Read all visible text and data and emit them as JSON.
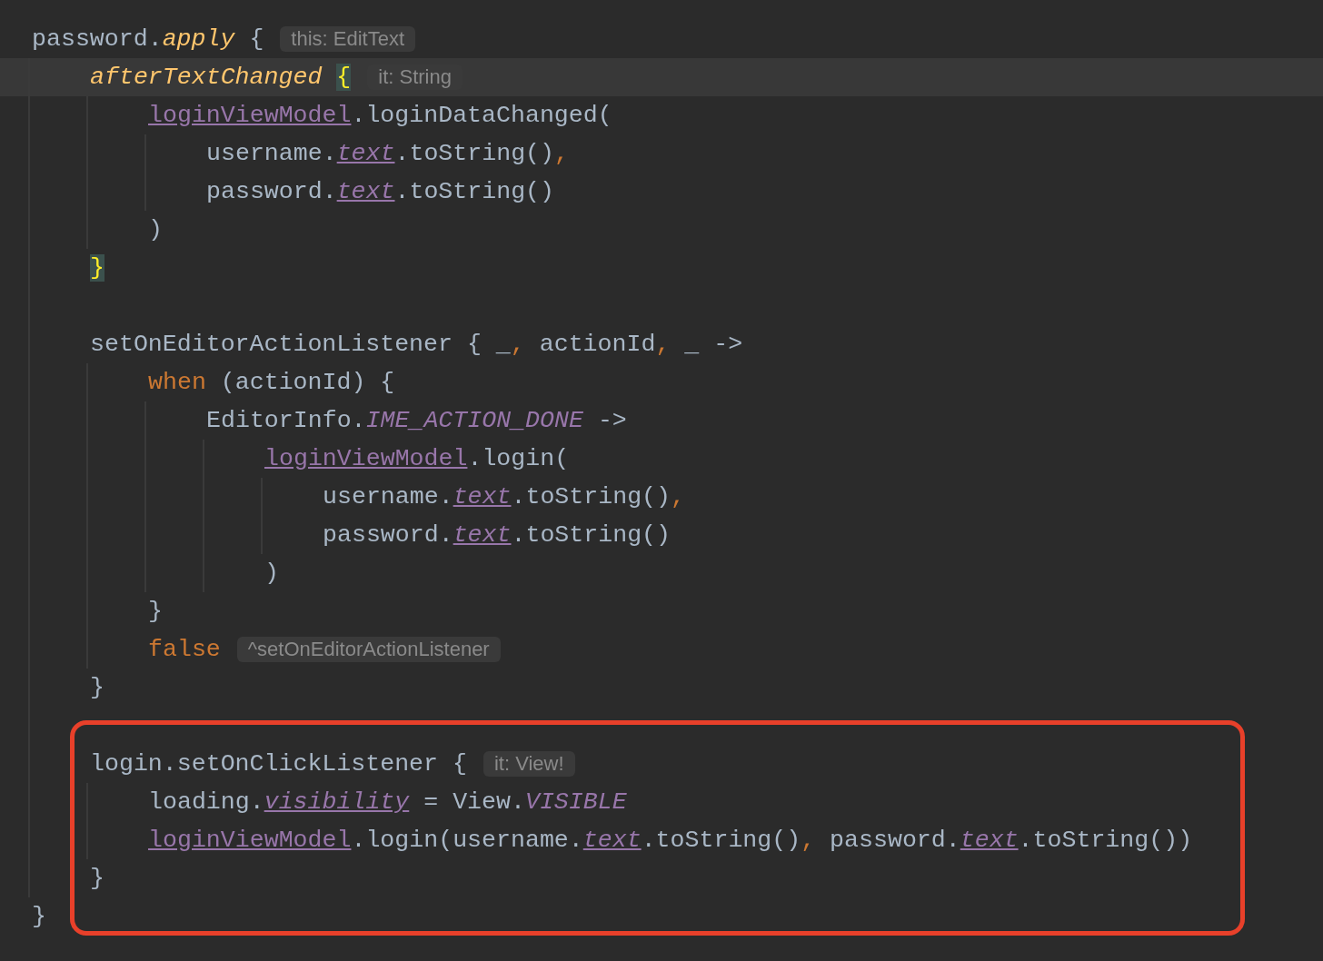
{
  "editor": {
    "lines": [
      {
        "current": false,
        "tokens": [
          {
            "kind": "plain",
            "text": "password."
          },
          {
            "kind": "fn",
            "text": "apply"
          },
          {
            "kind": "plain",
            "text": " {"
          }
        ],
        "hint": "this: EditText",
        "children": [
          {
            "current": true,
            "tokens": [
              {
                "kind": "fn",
                "text": "afterTextChanged"
              },
              {
                "kind": "match",
                "text": "{"
              }
            ],
            "hint": "it: String",
            "children": [
              {
                "current": false,
                "tokens": [
                  {
                    "kind": "ref",
                    "text": "loginViewModel"
                  },
                  {
                    "kind": "plain",
                    "text": ".loginDataChanged("
                  }
                ],
                "children": [
                  {
                    "current": false,
                    "tokens": [
                      {
                        "kind": "plain",
                        "text": "username."
                      },
                      {
                        "kind": "field",
                        "text": "text"
                      },
                      {
                        "kind": "plain",
                        "text": ".toString()"
                      },
                      {
                        "kind": "kw",
                        "text": ","
                      }
                    ]
                  },
                  {
                    "current": false,
                    "tokens": [
                      {
                        "kind": "plain",
                        "text": "password."
                      },
                      {
                        "kind": "field",
                        "text": "text"
                      },
                      {
                        "kind": "plain",
                        "text": ".toString()"
                      }
                    ]
                  }
                ]
              },
              {
                "current": false,
                "tokens": [
                  {
                    "kind": "plain",
                    "text": ")"
                  }
                ]
              }
            ]
          },
          {
            "current": false,
            "tokens": [
              {
                "kind": "match",
                "text": "}"
              }
            ]
          },
          {
            "current": false
          },
          {
            "current": false,
            "tokens": [
              {
                "kind": "plain",
                "text": "setOnEditorActionListener { _"
              },
              {
                "kind": "kw",
                "text": ","
              },
              {
                "kind": "plain",
                "text": " actionId"
              },
              {
                "kind": "kw",
                "text": ","
              },
              {
                "kind": "plain",
                "text": " _ ->"
              }
            ],
            "children": [
              {
                "current": false,
                "tokens": [
                  {
                    "kind": "kw",
                    "text": "when"
                  },
                  {
                    "kind": "plain",
                    "text": " (actionId) {"
                  }
                ],
                "children": [
                  {
                    "current": false,
                    "tokens": [
                      {
                        "kind": "plain",
                        "text": "EditorInfo."
                      },
                      {
                        "kind": "const",
                        "text": "IME_ACTION_DONE"
                      },
                      {
                        "kind": "plain",
                        "text": " ->"
                      }
                    ],
                    "children": [
                      {
                        "current": false,
                        "tokens": [
                          {
                            "kind": "ref",
                            "text": "loginViewModel"
                          },
                          {
                            "kind": "plain",
                            "text": ".login("
                          }
                        ],
                        "children": [
                          {
                            "current": false,
                            "tokens": [
                              {
                                "kind": "plain",
                                "text": "username."
                              },
                              {
                                "kind": "field",
                                "text": "text"
                              },
                              {
                                "kind": "plain",
                                "text": ".toString()"
                              },
                              {
                                "kind": "kw",
                                "text": ","
                              }
                            ]
                          },
                          {
                            "current": false,
                            "tokens": [
                              {
                                "kind": "plain",
                                "text": "password."
                              },
                              {
                                "kind": "field",
                                "text": "text"
                              },
                              {
                                "kind": "plain",
                                "text": ".toString()"
                              }
                            ]
                          }
                        ]
                      },
                      {
                        "current": false,
                        "tokens": [
                          {
                            "kind": "plain",
                            "text": ")"
                          }
                        ]
                      }
                    ]
                  }
                ]
              },
              {
                "current": false,
                "tokens": [
                  {
                    "kind": "plain",
                    "text": "}"
                  }
                ]
              },
              {
                "current": false,
                "tokens": [
                  {
                    "kind": "kw",
                    "text": "false"
                  }
                ],
                "hint": "^setOnEditorActionListener"
              }
            ]
          },
          {
            "current": false,
            "tokens": [
              {
                "kind": "plain",
                "text": "}"
              }
            ]
          },
          {
            "current": false
          },
          {
            "current": false,
            "tokens": [
              {
                "kind": "plain",
                "text": "login.setOnClickListener {"
              }
            ],
            "hint": "it: View!",
            "children": [
              {
                "current": false,
                "tokens": [
                  {
                    "kind": "plain",
                    "text": "loading."
                  },
                  {
                    "kind": "field",
                    "text": "visibility"
                  },
                  {
                    "kind": "plain",
                    "text": " = View."
                  },
                  {
                    "kind": "const",
                    "text": "VISIBLE"
                  }
                ]
              },
              {
                "current": false,
                "tokens": [
                  {
                    "kind": "ref",
                    "text": "loginViewModel"
                  },
                  {
                    "kind": "plain",
                    "text": ".login(username."
                  },
                  {
                    "kind": "field",
                    "text": "text"
                  },
                  {
                    "kind": "plain",
                    "text": ".toString()"
                  },
                  {
                    "kind": "kw",
                    "text": ","
                  },
                  {
                    "kind": "plain",
                    "text": " password."
                  },
                  {
                    "kind": "field",
                    "text": "text"
                  },
                  {
                    "kind": "plain",
                    "text": ".toString())"
                  }
                ]
              }
            ]
          },
          {
            "current": false,
            "tokens": [
              {
                "kind": "plain",
                "text": "}"
              }
            ]
          }
        ]
      },
      {
        "current": false,
        "tokens": [
          {
            "kind": "plain",
            "text": "}"
          }
        ]
      }
    ]
  }
}
